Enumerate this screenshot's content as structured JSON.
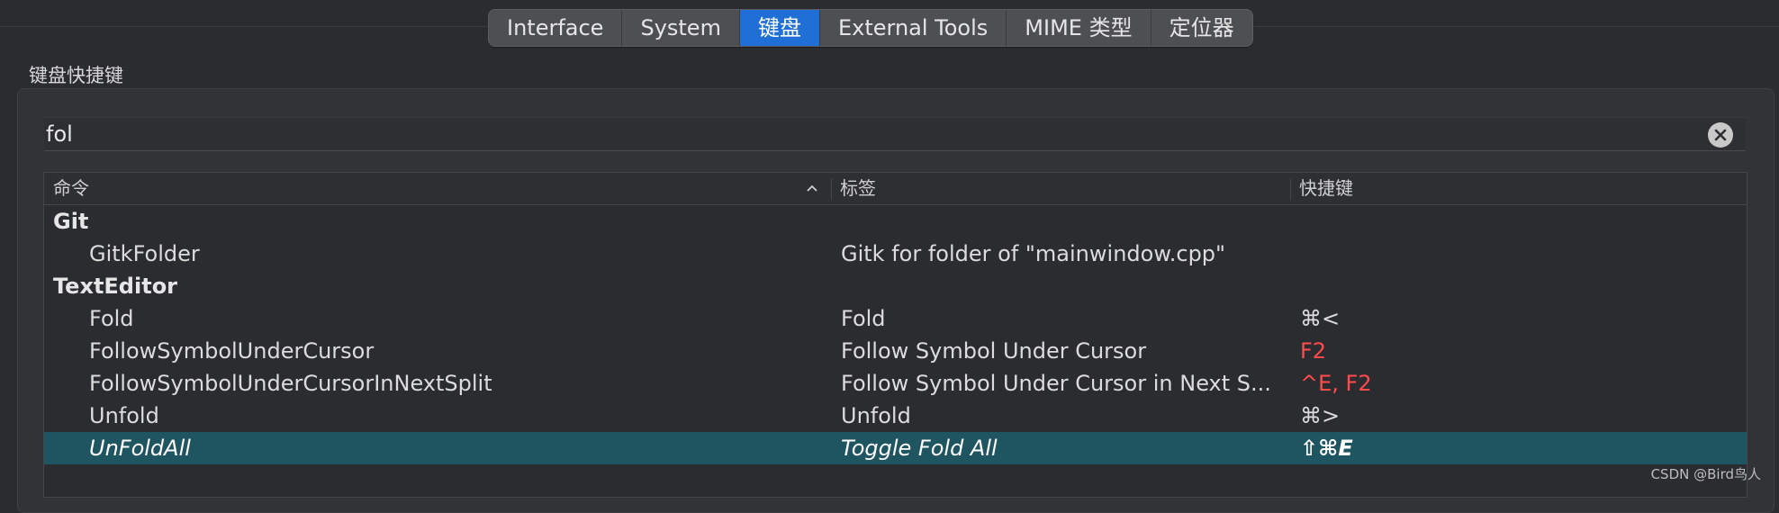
{
  "tabs": [
    {
      "label": "Interface",
      "active": false
    },
    {
      "label": "System",
      "active": false
    },
    {
      "label": "键盘",
      "active": true
    },
    {
      "label": "External Tools",
      "active": false
    },
    {
      "label": "MIME 类型",
      "active": false
    },
    {
      "label": "定位器",
      "active": false
    }
  ],
  "group_title": "键盘快捷键",
  "search": {
    "value": "fol"
  },
  "table": {
    "columns": [
      "命令",
      "标签",
      "快捷键"
    ],
    "groups": [
      {
        "name": "Git"
      },
      {
        "name": "TextEditor"
      }
    ],
    "rows": [
      {
        "command": "GitkFolder",
        "label": "Gitk for folder of \"mainwindow.cpp\"",
        "shortcut": ""
      },
      {
        "command": "Fold",
        "label": "Fold",
        "shortcut": "⌘<"
      },
      {
        "command": "FollowSymbolUnderCursor",
        "label": "Follow Symbol Under Cursor",
        "shortcut": "F2"
      },
      {
        "command": "FollowSymbolUnderCursorInNextSplit",
        "label": "Follow Symbol Under Cursor in Next S...",
        "shortcut": "^E, F2"
      },
      {
        "command": "Unfold",
        "label": "Unfold",
        "shortcut": "⌘>"
      },
      {
        "command": "UnFoldAll",
        "label": "Toggle Fold All",
        "shortcut": "⇧⌘E"
      }
    ]
  },
  "colors": {
    "accent": "#1f6fd6",
    "selection": "#1f5560",
    "conflict": "#ff4b4b"
  },
  "watermark": "CSDN @Bird鸟人"
}
